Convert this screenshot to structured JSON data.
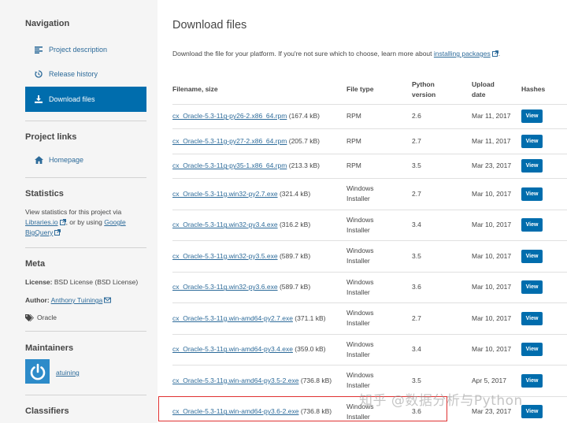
{
  "sidebar": {
    "navigation": {
      "heading": "Navigation",
      "items": [
        {
          "label": "Project description",
          "icon": "align-left-icon"
        },
        {
          "label": "Release history",
          "icon": "history-icon"
        },
        {
          "label": "Download files",
          "icon": "download-icon",
          "active": true
        }
      ]
    },
    "project_links": {
      "heading": "Project links",
      "homepage_label": "Homepage"
    },
    "statistics": {
      "heading": "Statistics",
      "line1": "View statistics for this project via",
      "libraries_link": "Libraries.io",
      "or_text": ", or by using",
      "google_link": "Google",
      "bigquery_link": "BigQuery"
    },
    "meta": {
      "heading": "Meta",
      "license_label": "License:",
      "license_value": "BSD License (BSD License)",
      "author_label": "Author:",
      "author_value": "Anthony Tuininga",
      "tag": "Oracle"
    },
    "maintainers": {
      "heading": "Maintainers",
      "username": "atuining"
    },
    "classifiers": {
      "heading": "Classifiers"
    }
  },
  "main": {
    "title": "Download files",
    "intro_text": "Download the file for your platform. If you're not sure which to choose, learn more about",
    "intro_link": "installing packages",
    "intro_end": ".",
    "columns": {
      "filename": "Filename, size",
      "filetype": "File type",
      "python_line1": "Python",
      "python_line2": "version",
      "upload_line1": "Upload",
      "upload_line2": "date",
      "hashes": "Hashes"
    },
    "view_label": "View",
    "files": [
      {
        "name": "cx_Oracle-5.3-11g-py26-2.x86_64.rpm",
        "size": "(167.4 kB)",
        "type1": "RPM",
        "type2": "",
        "python": "2.6",
        "date": "Mar 11, 2017"
      },
      {
        "name": "cx_Oracle-5.3-11g-py27-2.x86_64.rpm",
        "size": "(205.7 kB)",
        "type1": "RPM",
        "type2": "",
        "python": "2.7",
        "date": "Mar 11, 2017"
      },
      {
        "name": "cx_Oracle-5.3-11g-py35-1.x86_64.rpm",
        "size": "(213.3 kB)",
        "type1": "RPM",
        "type2": "",
        "python": "3.5",
        "date": "Mar 23, 2017"
      },
      {
        "name": "cx_Oracle-5.3-11g.win32-py2.7.exe",
        "size": "(321.4 kB)",
        "type1": "Windows",
        "type2": "Installer",
        "python": "2.7",
        "date": "Mar 10, 2017"
      },
      {
        "name": "cx_Oracle-5.3-11g.win32-py3.4.exe",
        "size": "(316.2 kB)",
        "type1": "Windows",
        "type2": "Installer",
        "python": "3.4",
        "date": "Mar 10, 2017"
      },
      {
        "name": "cx_Oracle-5.3-11g.win32-py3.5.exe",
        "size": "(589.7 kB)",
        "type1": "Windows",
        "type2": "Installer",
        "python": "3.5",
        "date": "Mar 10, 2017"
      },
      {
        "name": "cx_Oracle-5.3-11g.win32-py3.6.exe",
        "size": "(589.7 kB)",
        "type1": "Windows",
        "type2": "Installer",
        "python": "3.6",
        "date": "Mar 10, 2017"
      },
      {
        "name": "cx_Oracle-5.3-11g.win-amd64-py2.7.exe",
        "size": "(371.1 kB)",
        "type1": "Windows",
        "type2": "Installer",
        "python": "2.7",
        "date": "Mar 10, 2017"
      },
      {
        "name": "cx_Oracle-5.3-11g.win-amd64-py3.4.exe",
        "size": "(359.0 kB)",
        "type1": "Windows",
        "type2": "Installer",
        "python": "3.4",
        "date": "Mar 10, 2017"
      },
      {
        "name": "cx_Oracle-5.3-11g.win-amd64-py3.5-2.exe",
        "size": "(736.8 kB)",
        "type1": "Windows",
        "type2": "Installer",
        "python": "3.5",
        "date": "Apr 5, 2017"
      },
      {
        "name": "cx_Oracle-5.3-11g.win-amd64-py3.6-2.exe",
        "size": "(736.8 kB)",
        "type1": "Windows",
        "type2": "Installer",
        "python": "3.6",
        "date": "Mar 23, 2017"
      }
    ]
  },
  "watermark": "知乎 @数据分析与Python",
  "colors": {
    "accent": "#006dad",
    "link": "#2d6b9a",
    "highlight": "#e03030"
  }
}
